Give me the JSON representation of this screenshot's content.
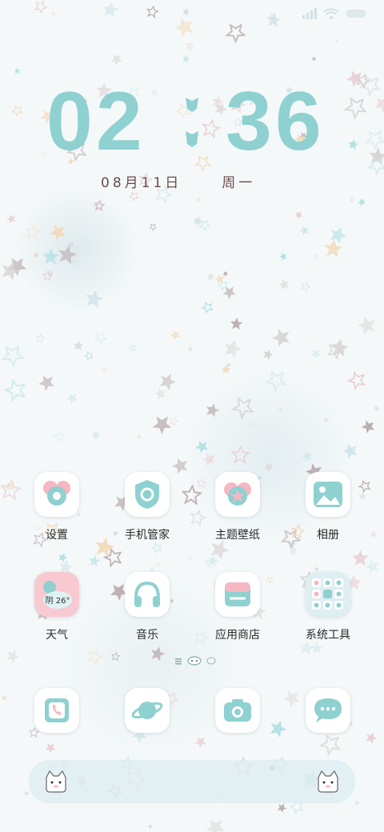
{
  "clock": {
    "hours": "02",
    "minutes": "36",
    "date": "08月11日",
    "weekday": "周一"
  },
  "apps": [
    {
      "label": "设置",
      "icon": "settings-gear-icon"
    },
    {
      "label": "手机管家",
      "icon": "shield-icon"
    },
    {
      "label": "主题壁纸",
      "icon": "theme-star-icon"
    },
    {
      "label": "相册",
      "icon": "gallery-icon"
    },
    {
      "label": "天气",
      "icon": "weather-cloud-icon",
      "badge": "阴 26°"
    },
    {
      "label": "音乐",
      "icon": "headphones-icon"
    },
    {
      "label": "应用商店",
      "icon": "app-store-icon"
    },
    {
      "label": "系统工具",
      "icon": "folder-icon"
    }
  ],
  "dock": [
    {
      "icon": "phone-icon"
    },
    {
      "icon": "browser-planet-icon"
    },
    {
      "icon": "camera-icon"
    },
    {
      "icon": "messages-icon"
    }
  ],
  "colors": {
    "accent": "#8fd0d0",
    "pink": "#f6b7c2",
    "text": "#2b2b2b"
  }
}
